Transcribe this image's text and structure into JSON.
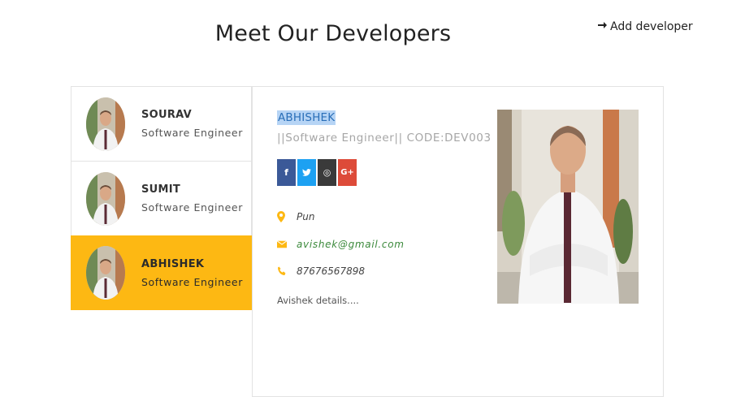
{
  "page": {
    "title": "Meet Our Developers",
    "add_developer_label": "Add developer"
  },
  "developers": [
    {
      "name": "SOURAV",
      "role": "Software Engineer",
      "active": false
    },
    {
      "name": "SUMIT",
      "role": "Software Engineer",
      "active": false
    },
    {
      "name": "ABHISHEK",
      "role": "Software Engineer",
      "active": true
    }
  ],
  "detail": {
    "name": "ABHISHEK",
    "subtitle": "||Software Engineer|| CODE:DEV003",
    "socials": [
      {
        "icon": "facebook-icon",
        "glyph": "f"
      },
      {
        "icon": "twitter-icon",
        "glyph": "t"
      },
      {
        "icon": "instagram-icon",
        "glyph": "◎"
      },
      {
        "icon": "google-plus-icon",
        "glyph": "G+"
      }
    ],
    "location": "Pun",
    "email": "avishek@gmail.com",
    "phone": "87676567898",
    "description": "Avishek details...."
  },
  "colors": {
    "accent": "#fdb813",
    "facebook": "#3b5998",
    "twitter": "#1da1f2",
    "instagram": "#3a3a3a",
    "google_plus": "#dd4b39",
    "selection": "#b6d4f5"
  }
}
